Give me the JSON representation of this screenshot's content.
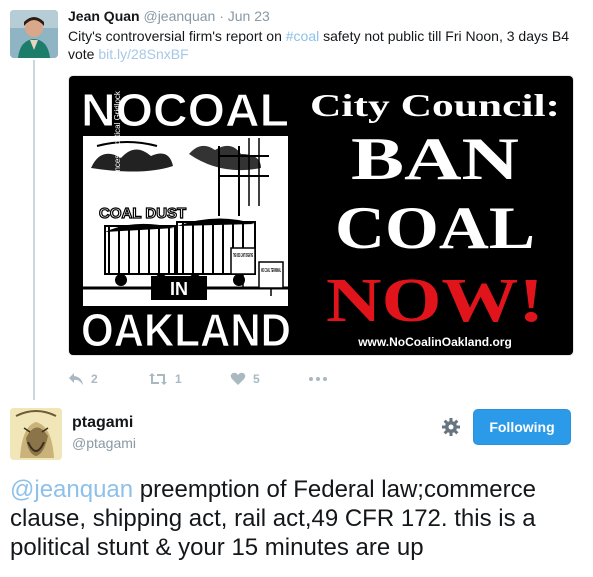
{
  "tweet1": {
    "author_name": "Jean Quan",
    "author_handle": "@jeanquan",
    "separator": "·",
    "time": "Jun 23",
    "text_before": "City's controversial firm's report on ",
    "hashtag": "#coal",
    "text_middle": " safety not public till Fri Noon, 3 days B4 vote ",
    "link": "bit.ly/28SnxBF",
    "media": {
      "left_top": "NOCOAL",
      "coal_dust": "COAL DUST",
      "in": "IN",
      "left_bottom": "OAKLAND",
      "sign1": "THE KIDS CAN'T BREATHE",
      "sign2": "NO COAL TERMINAL",
      "credit": "Jos Sances, Political Gridlock",
      "headline": "City Council:",
      "line1": "BAN",
      "line2": "COAL",
      "line3": "NOW!",
      "url": "www.NoCoalinOakland.org"
    },
    "actions": {
      "reply_count": "2",
      "retweet_count": "1",
      "like_count": "5"
    }
  },
  "tweet2": {
    "author_name": "ptagami",
    "author_handle": "@ptagami",
    "follow_label": "Following",
    "mention": "@jeanquan",
    "text": " preemption of Federal law;commerce clause, shipping act, rail act,49 CFR 172. this is a political stunt & your 15 minutes are up"
  },
  "colors": {
    "link_blue": "#8ec1ea",
    "button_blue": "#2b9ae8",
    "muted": "#8899a6",
    "poster_red": "#e1141c"
  }
}
